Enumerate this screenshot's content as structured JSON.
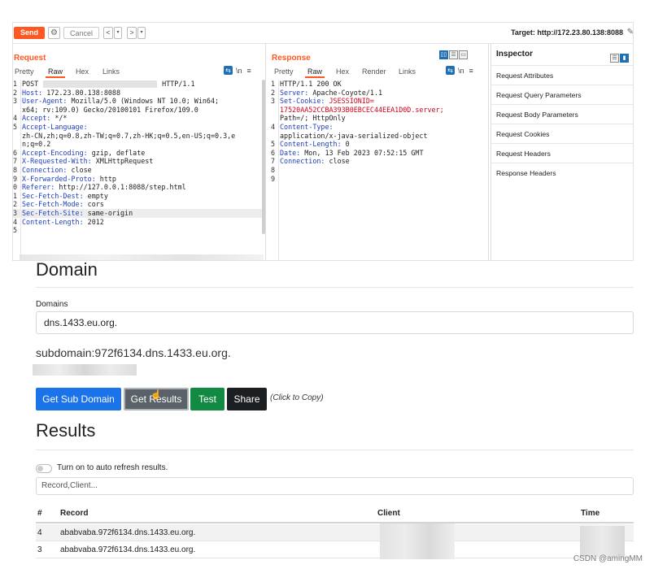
{
  "burp": {
    "toolbar": {
      "send": "Send",
      "cancel": "Cancel",
      "back": "<",
      "forward": ">",
      "dropdown": "▾",
      "target": "Target: http://172.23.80.138:8088"
    },
    "request": {
      "title": "Request",
      "tabs": [
        "Pretty",
        "Raw",
        "Hex",
        "Links"
      ],
      "active_tab": "Raw",
      "icon_newline": "\\n",
      "icon_menu": "≡",
      "lines": [
        {
          "n": "1",
          "key": "",
          "val": "POST",
          "blur": true,
          "tail": "HTTP/1.1"
        },
        {
          "n": "2",
          "key": "Host:",
          "val": " 172.23.80.138:8088"
        },
        {
          "n": "3",
          "key": "User-Agent:",
          "val": " Mozilla/5.0 (Windows NT 10.0; Win64;"
        },
        {
          "n": "",
          "key": "",
          "val": "x64; rv:109.0) Gecko/20100101 Firefox/109.0"
        },
        {
          "n": "4",
          "key": "Accept:",
          "val": " */*"
        },
        {
          "n": "5",
          "key": "Accept-Language:",
          "val": ""
        },
        {
          "n": "",
          "key": "",
          "val": "zh-CN,zh;q=0.8,zh-TW;q=0.7,zh-HK;q=0.5,en-US;q=0.3,e"
        },
        {
          "n": "",
          "key": "",
          "val": "n;q=0.2"
        },
        {
          "n": "6",
          "key": "Accept-Encoding:",
          "val": " gzip, deflate"
        },
        {
          "n": "7",
          "key": "X-Requested-With:",
          "val": " XMLHttpRequest"
        },
        {
          "n": "8",
          "key": "Connection:",
          "val": " close"
        },
        {
          "n": "9",
          "key": "X-Forwarded-Proto:",
          "val": " http"
        },
        {
          "n": "0",
          "key": "Referer:",
          "val": " http://127.0.0.1:8088/step.html"
        },
        {
          "n": "1",
          "key": "Sec-Fetch-Dest:",
          "val": " empty"
        },
        {
          "n": "2",
          "key": "Sec-Fetch-Mode:",
          "val": " cors"
        },
        {
          "n": "3",
          "key": "Sec-Fetch-Site:",
          "val": " same-origin",
          "highlight": true
        },
        {
          "n": "4",
          "key": "Content-Length:",
          "val": " 2012"
        },
        {
          "n": "5",
          "key": "",
          "val": ""
        }
      ]
    },
    "response": {
      "title": "Response",
      "tabs": [
        "Pretty",
        "Raw",
        "Hex",
        "Render",
        "Links"
      ],
      "active_tab": "Raw",
      "icon_newline": "\\n",
      "icon_menu": "≡",
      "lines": [
        {
          "n": "1",
          "key": "",
          "val": "HTTP/1.1 200 OK"
        },
        {
          "n": "2",
          "key": "Server:",
          "val": " Apache-Coyote/1.1"
        },
        {
          "n": "3",
          "key": "Set-Cookie:",
          "val": " JSESSIONID=",
          "red": true
        },
        {
          "n": "",
          "key": "",
          "val": "17520AA52CCBA393B0EBCEC44EEA1D0D.server;",
          "red": true
        },
        {
          "n": "",
          "key": "",
          "val": "Path=/; HttpOnly"
        },
        {
          "n": "4",
          "key": "Content-Type:",
          "val": ""
        },
        {
          "n": "",
          "key": "",
          "val": "application/x-java-serialized-object"
        },
        {
          "n": "5",
          "key": "Content-Length:",
          "val": " 0"
        },
        {
          "n": "6",
          "key": "Date:",
          "val": " Mon, 13 Feb 2023 07:52:15 GMT"
        },
        {
          "n": "7",
          "key": "Connection:",
          "val": " close"
        },
        {
          "n": "8",
          "key": "",
          "val": ""
        },
        {
          "n": "9",
          "key": "",
          "val": ""
        }
      ]
    },
    "inspector": {
      "title": "Inspector",
      "items": [
        "Request Attributes",
        "Request Query Parameters",
        "Request Body Parameters",
        "Request Cookies",
        "Request Headers",
        "Response Headers"
      ]
    }
  },
  "web": {
    "domain_heading": "Domain",
    "domains_label": "Domains",
    "domain_value": "dns.1433.eu.org.",
    "subdomain_text": "subdomain:972f6134.dns.1433.eu.org.",
    "buttons": {
      "get_sub_domain": "Get Sub Domain",
      "get_results": "Get Results",
      "test": "Test",
      "share": "Share"
    },
    "copy_note": "(Click to Copy)",
    "results_heading": "Results",
    "toggle_label": "Turn on to auto refresh results.",
    "filter_placeholder": "Record,Client...",
    "table": {
      "headers": [
        "#",
        "Record",
        "Client",
        "Time"
      ],
      "rows": [
        {
          "num": "4",
          "record": "ababvaba.972f6134.dns.1433.eu.org."
        },
        {
          "num": "3",
          "record": "ababvaba.972f6134.dns.1433.eu.org."
        }
      ]
    }
  },
  "watermark": "CSDN @amingMM",
  "colors": {
    "send": "#ff5722",
    "accent_orange": "#ff5722",
    "header_key_blue": "#1e3fbf",
    "cookie_red": "#d0021b",
    "btn_blue": "#1a73e8",
    "btn_grey": "#5a6168",
    "btn_green": "#138a43",
    "btn_black": "#1c1f22"
  }
}
